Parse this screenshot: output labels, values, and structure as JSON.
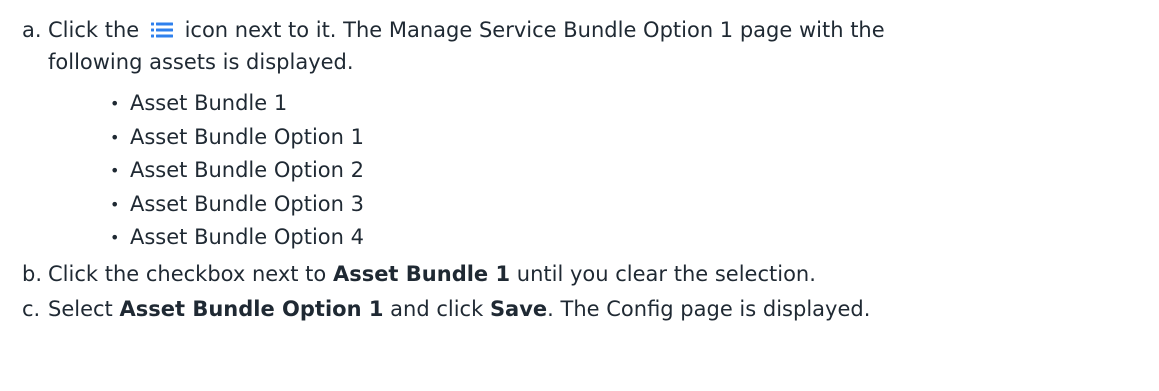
{
  "steps": [
    {
      "marker": "a.",
      "pre": "Click the",
      "icon": "list-icon",
      "post": "icon next to it. The Manage Service Bundle Option 1 page with the",
      "continuation": "following assets is displayed.",
      "assets": [
        "Asset Bundle 1",
        "Asset Bundle Option 1",
        "Asset Bundle Option 2",
        "Asset Bundle Option 3",
        "Asset Bundle Option 4"
      ]
    },
    {
      "marker": "b.",
      "pre": "Click the checkbox next to",
      "bold": "Asset Bundle 1",
      "post": "until you clear the selection."
    },
    {
      "marker": "c.",
      "pre": "Select",
      "bold1": "Asset Bundle Option 1",
      "mid": "and click",
      "bold2": "Save",
      "post": ". The Config page is displayed."
    }
  ],
  "colors": {
    "text": "#1f2933",
    "icon": "#2f80ed"
  }
}
